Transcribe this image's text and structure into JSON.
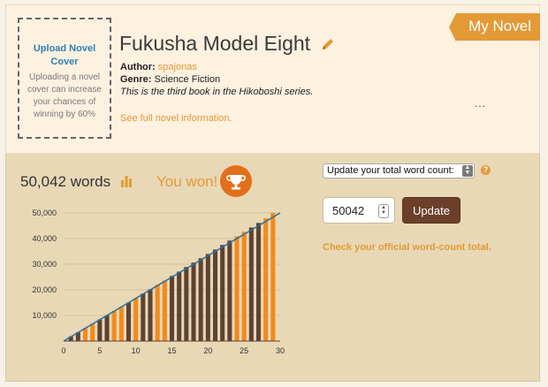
{
  "badge": "My Novel",
  "cover": {
    "upload_label": "Upload Novel Cover",
    "hint": "Uploading a novel cover can increase your chances of winning by 60%"
  },
  "novel": {
    "title": "Fukusha Model Eight",
    "author_label": "Author:",
    "author": "spajonas",
    "genre_label": "Genre:",
    "genre": "Science Fiction",
    "description": "This is the third book in the Hikoboshi series.",
    "see_full": "See full novel information.",
    "more": "..."
  },
  "stats": {
    "words": "50,042 words",
    "won": "You won!"
  },
  "form": {
    "select_value": "Update your total word count:",
    "word_count_value": "50042",
    "update_label": "Update",
    "help": "?",
    "official_link": "Check your official word-count total."
  },
  "colors": {
    "accent": "#e39a36",
    "bar_dark": "#5e4232",
    "bar_orange": "#f28a1c",
    "target_line": "#2b6f9e",
    "button": "#6b3f2a"
  },
  "icons": {
    "edit": "pencil-icon",
    "stats": "bar-chart-icon",
    "winner": "trophy-icon",
    "select": "select-arrows-icon",
    "help": "help-icon"
  },
  "chart_data": {
    "type": "bar",
    "xlim": [
      0,
      30
    ],
    "ylim": [
      0,
      50000
    ],
    "xticks": [
      "0",
      "5",
      "10",
      "15",
      "20",
      "25",
      "30"
    ],
    "yticks": [
      "10,000",
      "20,000",
      "30,000",
      "40,000",
      "50,000"
    ],
    "grid": true,
    "days": [
      1,
      2,
      3,
      4,
      5,
      6,
      7,
      8,
      9,
      10,
      11,
      12,
      13,
      14,
      15,
      16,
      17,
      18,
      19,
      20,
      21,
      22,
      23,
      24,
      25,
      26,
      27,
      28,
      29
    ],
    "values": [
      1800,
      3400,
      5100,
      6800,
      8400,
      10000,
      11700,
      13400,
      15000,
      16800,
      18500,
      20200,
      22000,
      23600,
      25400,
      27100,
      28900,
      30600,
      32300,
      34000,
      35700,
      37500,
      39200,
      40900,
      42600,
      44300,
      46100,
      47900,
      50042
    ],
    "highlight": [
      false,
      false,
      true,
      true,
      false,
      false,
      true,
      true,
      false,
      true,
      false,
      false,
      true,
      true,
      false,
      false,
      false,
      false,
      false,
      false,
      false,
      false,
      false,
      true,
      true,
      false,
      false,
      true,
      true
    ],
    "target": [
      0,
      50000
    ]
  }
}
